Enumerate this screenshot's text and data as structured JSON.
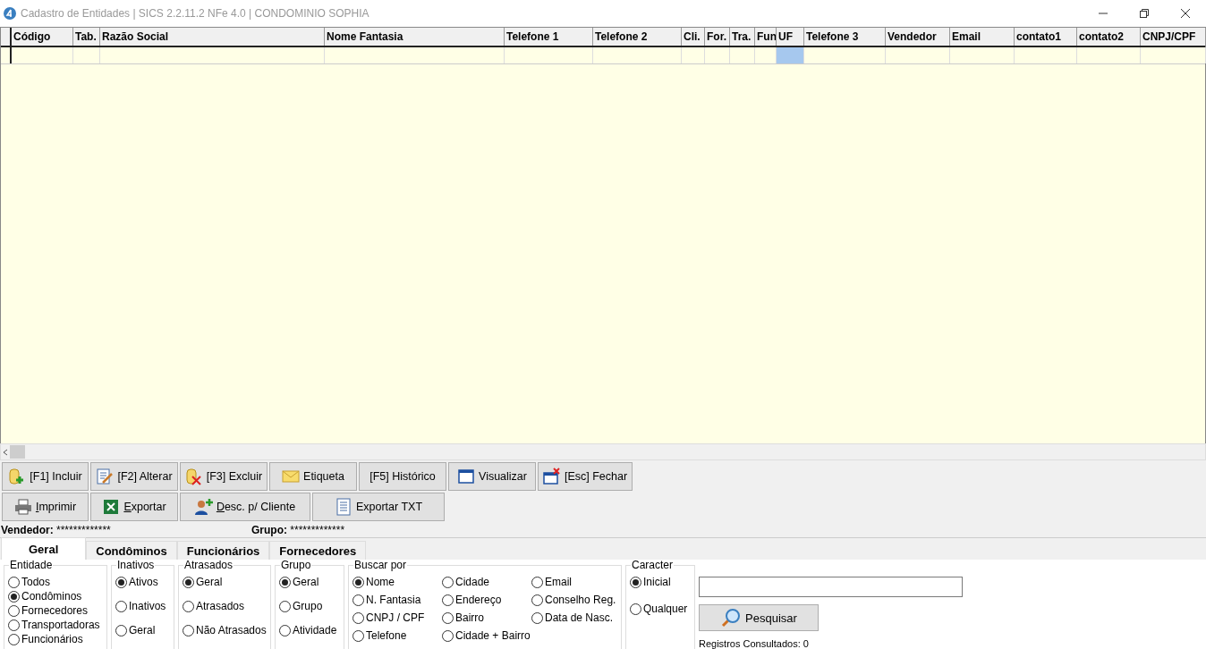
{
  "window": {
    "title": "Cadastro de Entidades | SICS 2.2.11.2 NFe 4.0 | CONDOMINIO SOPHIA"
  },
  "grid": {
    "columns": [
      {
        "label": "Código",
        "selected": false
      },
      {
        "label": "Tab.",
        "selected": false
      },
      {
        "label": "Razão Social",
        "selected": false
      },
      {
        "label": "Nome Fantasia",
        "selected": false
      },
      {
        "label": "Telefone 1",
        "selected": false
      },
      {
        "label": "Telefone 2",
        "selected": false
      },
      {
        "label": "Cli.",
        "selected": false
      },
      {
        "label": "For.",
        "selected": false
      },
      {
        "label": "Tra.",
        "selected": false
      },
      {
        "label": "Fun",
        "selected": false
      },
      {
        "label": "UF",
        "selected": true
      },
      {
        "label": "Telefone 3",
        "selected": false
      },
      {
        "label": "Vendedor",
        "selected": false
      },
      {
        "label": "Email",
        "selected": false
      },
      {
        "label": "contato1",
        "selected": false
      },
      {
        "label": "contato2",
        "selected": false
      },
      {
        "label": "CNPJ/CPF",
        "selected": false
      }
    ]
  },
  "toolbar": [
    [
      {
        "kind": "add",
        "label": "[F1] Incluir"
      },
      {
        "kind": "edit",
        "label": "[F2] Alterar"
      },
      {
        "kind": "delete",
        "label": "[F3] Excluir"
      },
      {
        "kind": "mail",
        "label": "Etiqueta"
      },
      {
        "kind": "plain",
        "label": "[F5] Histórico"
      },
      {
        "kind": "window",
        "label": "Visualizar"
      },
      {
        "kind": "close-window",
        "label": "[Esc] Fechar"
      }
    ],
    [
      {
        "kind": "print",
        "label": "Imprimir",
        "accelerator": true
      },
      {
        "kind": "spreadsheet",
        "label": "Exportar",
        "accelerator": true
      },
      {
        "kind": "user-add",
        "label": "Desc. p/ Cliente",
        "accelerator": true
      },
      {
        "kind": "document",
        "label": "Exportar TXT"
      }
    ]
  ],
  "info": [
    {
      "label": "Vendedor:",
      "value": "*************"
    },
    {
      "label": "Grupo:",
      "value": "*************"
    }
  ],
  "tabs": [
    {
      "label": "Geral",
      "selected": true
    },
    {
      "label": "Condôminos",
      "selected": false
    },
    {
      "label": "Funcionários",
      "selected": false
    },
    {
      "label": "Fornecedores",
      "selected": false
    }
  ],
  "filters": [
    {
      "title": "Entidade",
      "options": [
        {
          "label": "Todos",
          "selected": false
        },
        {
          "label": "Condôminos",
          "selected": true
        },
        {
          "label": "Fornecedores",
          "selected": false
        },
        {
          "label": "Transportadoras",
          "selected": false
        },
        {
          "label": "Funcionários",
          "selected": false
        }
      ]
    },
    {
      "title": "Inativos",
      "options": [
        {
          "label": "Ativos",
          "selected": true
        },
        {
          "label": "Inativos",
          "selected": false
        },
        {
          "label": "Geral",
          "selected": false
        }
      ]
    },
    {
      "title": "Atrasados",
      "options": [
        {
          "label": "Geral",
          "selected": true
        },
        {
          "label": "Atrasados",
          "selected": false
        },
        {
          "label": "Não Atrasados",
          "selected": false
        }
      ]
    },
    {
      "title": "Grupo",
      "options": [
        {
          "label": "Geral",
          "selected": true
        },
        {
          "label": "Grupo",
          "selected": false
        },
        {
          "label": "Atividade",
          "selected": false
        }
      ]
    },
    {
      "title": "Buscar por",
      "options": [
        {
          "label": "Nome",
          "selected": true
        },
        {
          "label": "N. Fantasia",
          "selected": false
        },
        {
          "label": "CNPJ / CPF",
          "selected": false
        },
        {
          "label": "Telefone",
          "selected": false
        },
        {
          "label": "Cidade",
          "selected": false
        },
        {
          "label": "Endereço",
          "selected": false
        },
        {
          "label": "Bairro",
          "selected": false
        },
        {
          "label": "Cidade + Bairro",
          "selected": false
        },
        {
          "label": "Email",
          "selected": false
        },
        {
          "label": "Conselho Reg.",
          "selected": false
        },
        {
          "label": "Data de Nasc.",
          "selected": false
        }
      ]
    },
    {
      "title": "Caracter",
      "options": [
        {
          "label": "Inicial",
          "selected": true
        },
        {
          "label": "Qualquer",
          "selected": false
        }
      ]
    }
  ],
  "search": {
    "button": "Pesquisar",
    "status": "Registros Consultados: 0"
  }
}
